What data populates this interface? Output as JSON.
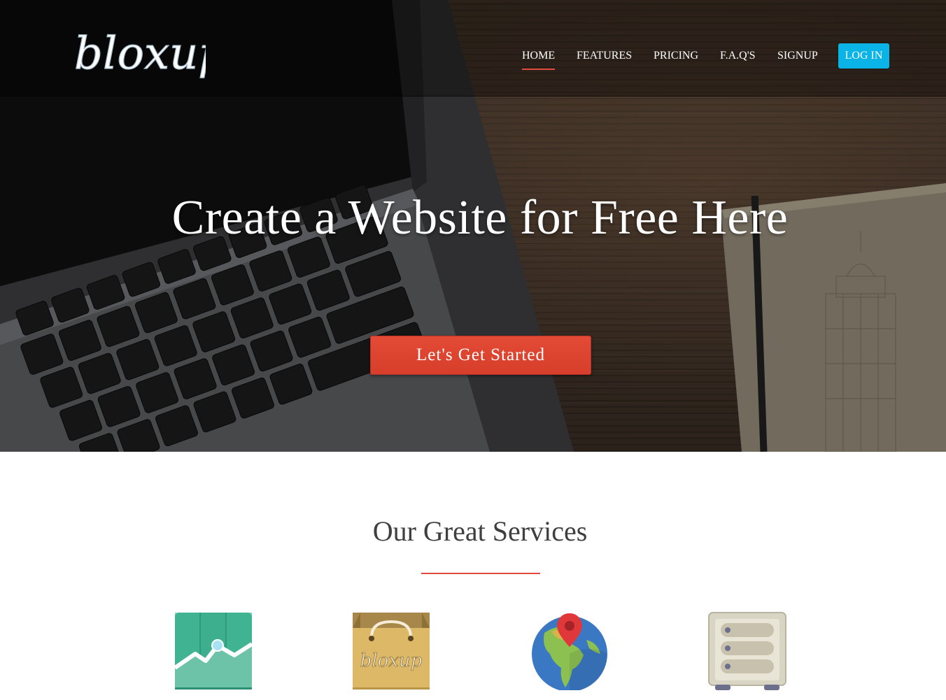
{
  "brand": {
    "logo_text": "bloxup"
  },
  "nav": {
    "items": [
      {
        "label": "HOME",
        "active": true
      },
      {
        "label": "FEATURES",
        "active": false
      },
      {
        "label": "PRICING",
        "active": false
      },
      {
        "label": "F.A.Q'S",
        "active": false
      },
      {
        "label": "SIGNUP",
        "active": false
      }
    ],
    "login_label": "LOG IN"
  },
  "hero": {
    "title": "Create a Website for Free Here",
    "cta_label": "Let's Get Started"
  },
  "services": {
    "title": "Our Great Services",
    "icons": [
      "analytics-chart-icon",
      "shopping-bag-icon",
      "globe-map-pin-icon",
      "server-cabinet-icon"
    ],
    "bag_text": "bloxup"
  },
  "colors": {
    "accent_red": "#e04a3b",
    "login_blue": "#0ab4e6",
    "cta_red": "#d73e2b",
    "title_gray": "#3f3f3f"
  }
}
